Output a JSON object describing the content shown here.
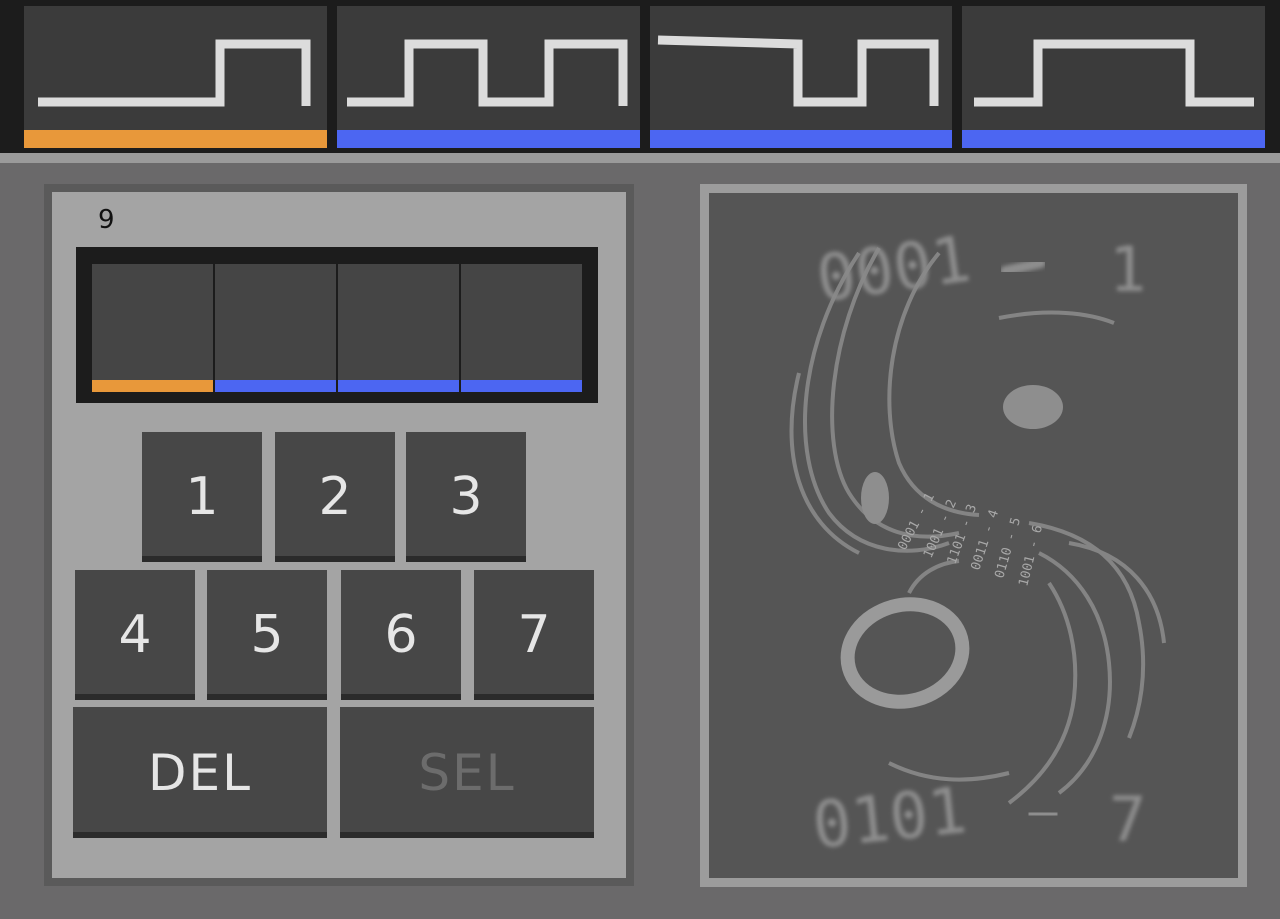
{
  "waveforms": [
    {
      "id": "A",
      "accent": "#e8983a"
    },
    {
      "id": "B",
      "accent": "#4c66f2"
    },
    {
      "id": "C",
      "accent": "#4c66f2"
    },
    {
      "id": "D",
      "accent": "#4c66f2"
    }
  ],
  "entry_count": "9",
  "display_cells": [
    {
      "accent": "#e8983a"
    },
    {
      "accent": "#4c66f2"
    },
    {
      "accent": "#4c66f2"
    },
    {
      "accent": "#4c66f2"
    }
  ],
  "keypad": {
    "row1": [
      "1",
      "2",
      "3"
    ],
    "row2": [
      "4",
      "5",
      "6",
      "7"
    ],
    "del_label": "DEL",
    "sel_label": "SEL"
  },
  "picture": {
    "top_left": "0001",
    "top_right": "1",
    "bottom_left": "0101",
    "bottom_right": "7",
    "spiral_labels": [
      "0001 - 1",
      "1001 - 2",
      "1101 - 3",
      "0011 - 4",
      "0110 - 5",
      "1001 - 6"
    ]
  }
}
